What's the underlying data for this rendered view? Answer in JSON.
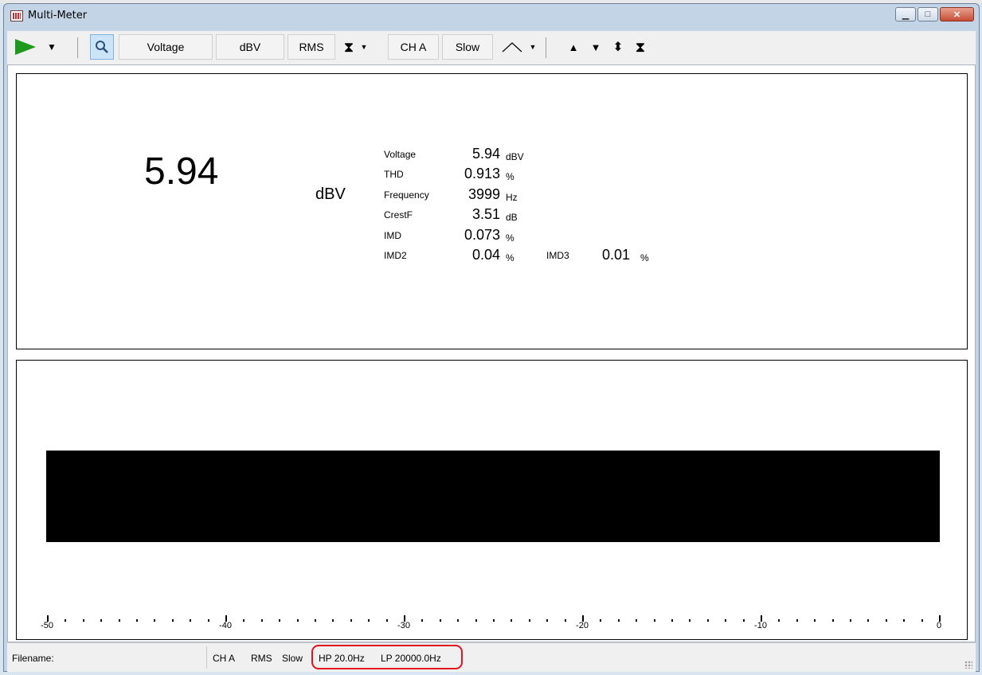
{
  "window": {
    "title": "Multi-Meter"
  },
  "toolbar": {
    "mode": "Voltage",
    "unit": "dBV",
    "detector": "RMS",
    "channel": "CH A",
    "speed": "Slow"
  },
  "display": {
    "main_value": "5.94",
    "main_unit": "dBV",
    "readings": [
      {
        "label": "Voltage",
        "value": "5.94",
        "unit": "dBV"
      },
      {
        "label": "THD",
        "value": "0.913",
        "unit": "%"
      },
      {
        "label": "Frequency",
        "value": "3999",
        "unit": "Hz"
      },
      {
        "label": "CrestF",
        "value": "3.51",
        "unit": "dB"
      },
      {
        "label": "IMD",
        "value": "0.073",
        "unit": "%"
      },
      {
        "label": "IMD2",
        "value": "0.04",
        "unit": "%"
      }
    ],
    "imd3": {
      "label": "IMD3",
      "value": "0.01",
      "unit": "%"
    }
  },
  "meter": {
    "scale_labels": [
      "-50",
      "-40",
      "-30",
      "-20",
      "-10",
      "0"
    ],
    "scale_min": -50,
    "scale_max": 0
  },
  "status": {
    "filename_label": "Filename:",
    "channel": "CH A",
    "detector": "RMS",
    "speed": "Slow",
    "hp": "HP 20.0Hz",
    "lp": "LP 20000.0Hz"
  },
  "colors": {
    "play": "#1d9a1d",
    "highlight": "#e0141e",
    "bar": "#000000"
  }
}
